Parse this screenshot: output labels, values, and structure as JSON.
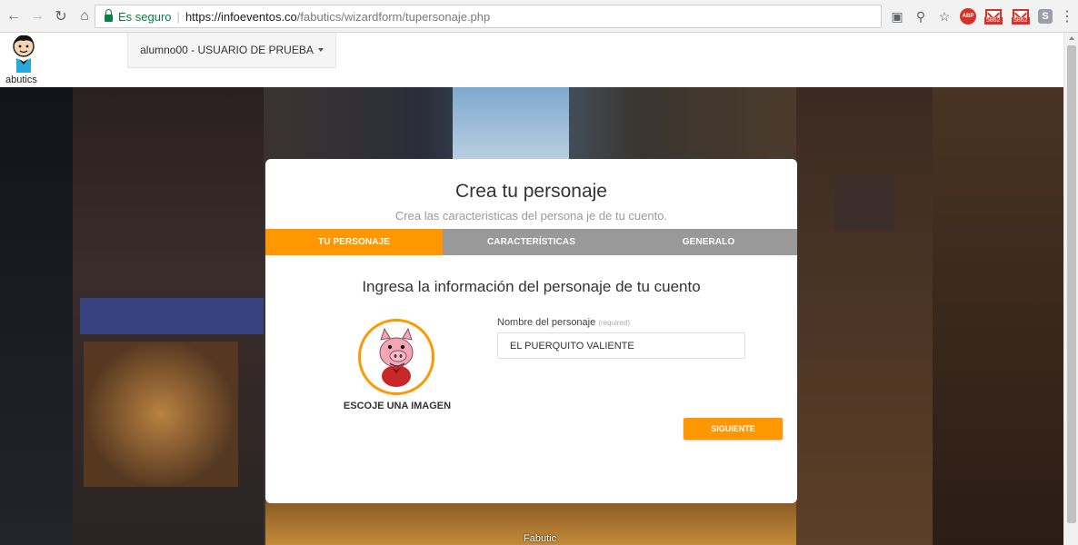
{
  "browser": {
    "secure_label": "Es seguro",
    "url_host": "https://infoeventos.co",
    "url_path": "/fabutics/wizardform/tupersonaje.php",
    "badge_count_1": "5862",
    "badge_count_2": "5862",
    "abp_label": "ABP"
  },
  "header": {
    "logo_text": "abutics",
    "user_menu": "alumno00 - USUARIO DE PRUEBA"
  },
  "card": {
    "title": "Crea tu personaje",
    "subtitle": "Crea las caracteristicas del persona je de tu cuento.",
    "tabs": [
      {
        "label": "TU PERSONAJE",
        "active": true
      },
      {
        "label": "CARACTERÍSTICAS",
        "active": false
      },
      {
        "label": "GENERALO",
        "active": false
      }
    ],
    "section_title": "Ingresa la información del personaje de tu cuento",
    "choose_image": "ESCOJE UNA IMAGEN",
    "name_label": "Nombre del personaje",
    "name_required": "(required)",
    "name_value": "EL PUERQUITO VALIENTE",
    "next_button": "SIGUIENTE"
  },
  "footer": {
    "brand": "Fabutic"
  },
  "colors": {
    "accent": "#ff9800",
    "tab_bg": "#999999",
    "secure": "#0b8043"
  }
}
